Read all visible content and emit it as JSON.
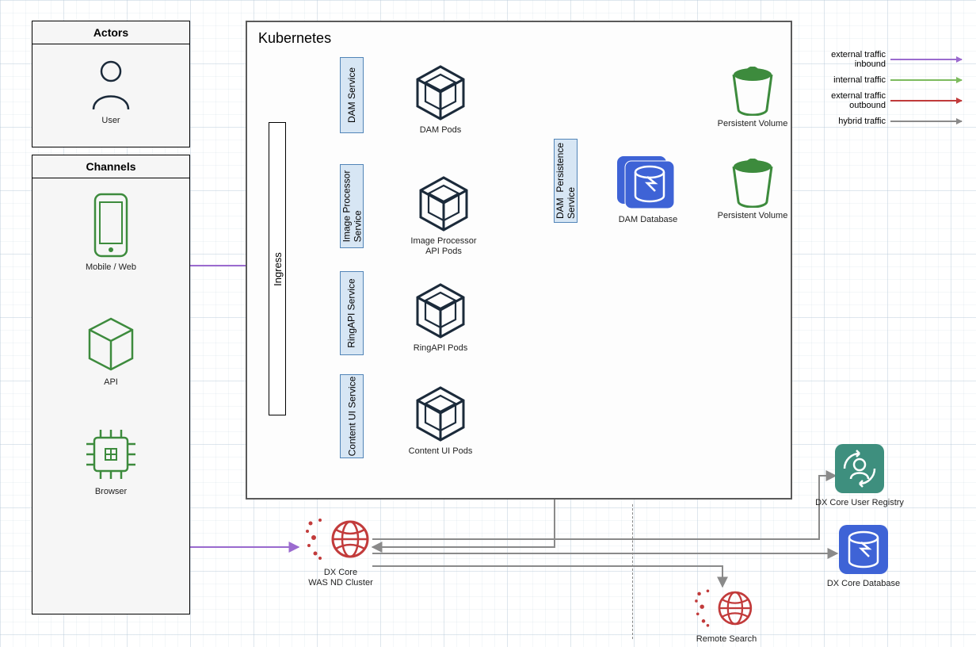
{
  "panels": {
    "actors": {
      "title": "Actors",
      "user": "User"
    },
    "channels": {
      "title": "Channels",
      "mobile": "Mobile / Web",
      "api": "API",
      "browser": "Browser"
    }
  },
  "kubernetes": {
    "title": "Kubernetes",
    "ingress": "Ingress",
    "services": {
      "dam": "DAM Service",
      "img": "Image Processor\nService",
      "ring": "RingAPI Service",
      "cui": "Content UI Service",
      "damPersist": "DAM  Persistence\nService"
    },
    "pods": {
      "dam": "DAM Pods",
      "img": "Image Processor\nAPI Pods",
      "ring": "RingAPI Pods",
      "cui": "Content UI Pods"
    },
    "pv1": "Persistent Volume",
    "pv2": "Persistent Volume",
    "damdb": "DAM Database"
  },
  "external": {
    "dxcore": "DX Core\nWAS ND Cluster",
    "remoteSearch": "Remote Search",
    "userRegistry": "DX Core User Registry",
    "dxdb": "DX Core Database"
  },
  "legend": {
    "ext_in": "external traffic\ninbound",
    "internal": "internal traffic",
    "ext_out": "external traffic\noutbound",
    "hybrid": "hybrid traffic"
  },
  "colors": {
    "purple": "#9b6bcf",
    "green_arrow": "#7dbb5e",
    "red": "#c23b3b",
    "grey": "#8a8a8a",
    "node_green": "#3d8b3d",
    "node_dark": "#1b2a3a",
    "pv_green": "#3d8b3d",
    "db_blue": "#3e63d6",
    "teal": "#3e8f7e"
  }
}
